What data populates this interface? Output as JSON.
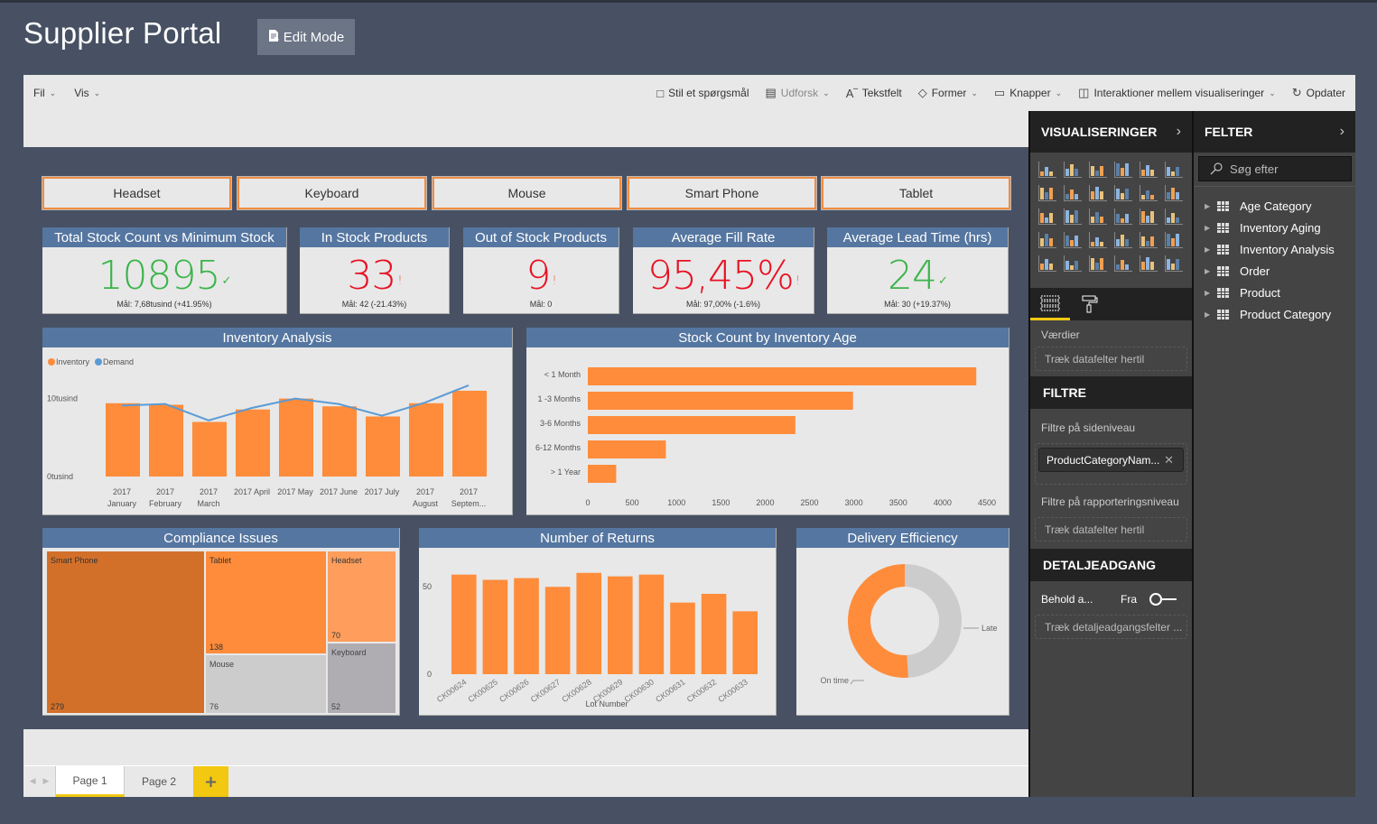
{
  "app": {
    "title": "Supplier Portal",
    "edit_mode_label": "Edit Mode"
  },
  "ribbon": {
    "left": [
      {
        "label": "Fil"
      },
      {
        "label": "Vis"
      }
    ],
    "right": [
      {
        "label": "Stil et spørgsmål",
        "icon": "speech-bubble-icon",
        "dropdown": false,
        "enabled": true
      },
      {
        "label": "Udforsk",
        "icon": "explore-icon",
        "dropdown": true,
        "enabled": false
      },
      {
        "label": "Tekstfelt",
        "icon": "textbox-icon",
        "dropdown": false,
        "enabled": true
      },
      {
        "label": "Former",
        "icon": "shapes-icon",
        "dropdown": true,
        "enabled": true
      },
      {
        "label": "Knapper",
        "icon": "buttons-icon",
        "dropdown": true,
        "enabled": true
      },
      {
        "label": "Interaktioner mellem visualiseringer",
        "icon": "interactions-icon",
        "dropdown": true,
        "enabled": true
      },
      {
        "label": "Opdater",
        "icon": "refresh-icon",
        "dropdown": false,
        "enabled": true
      }
    ]
  },
  "slicers": [
    "Headset",
    "Keyboard",
    "Mouse",
    "Smart Phone",
    "Tablet"
  ],
  "kpis": [
    {
      "title": "Total Stock Count vs Minimum Stock",
      "value": "10895",
      "status": "good",
      "flag": "✓",
      "goal": "Mål: 7,68tusind (+41.95%)"
    },
    {
      "title": "In Stock Products",
      "value": "33",
      "status": "bad",
      "flag": "!",
      "goal": "Mål: 42 (-21.43%)"
    },
    {
      "title": "Out of Stock Products",
      "value": "9",
      "status": "bad",
      "flag": "!",
      "goal": "Mål: 0"
    },
    {
      "title": "Average Fill Rate",
      "value": "95,45%",
      "status": "bad",
      "flag": "!",
      "goal": "Mål: 97,00% (-1.6%)"
    },
    {
      "title": "Average Lead Time (hrs)",
      "value": "24",
      "status": "good",
      "flag": "✓",
      "goal": "Mål: 30 (+19.37%)"
    }
  ],
  "colors": {
    "orange": "#fe8c3b",
    "blue": "#5b9bd5",
    "dark_orange": "#d2702a",
    "light_orange": "#ff9e5c",
    "grey": "#cccccc",
    "dark_grey": "#b0adb2",
    "title_bar": "#5576a0",
    "accent_yellow": "#f2c811"
  },
  "chart_data": [
    {
      "id": "inventory-analysis",
      "type": "bar",
      "title": "Inventory Analysis",
      "legend": [
        "Inventory",
        "Demand"
      ],
      "legend_position": "top-left",
      "categories": [
        "2017 January",
        "2017 February",
        "2017 March",
        "2017 April",
        "2017 May",
        "2017 June",
        "2017 July",
        "2017 August",
        "2017 Septem..."
      ],
      "category_lines": [
        [
          "2017",
          "January"
        ],
        [
          "2017",
          "February"
        ],
        [
          "2017",
          "March"
        ],
        [
          "2017 April"
        ],
        [
          "2017 May"
        ],
        [
          "2017 June"
        ],
        [
          "2017 July"
        ],
        [
          "2017",
          "August"
        ],
        [
          "2017",
          "Septem..."
        ]
      ],
      "series": [
        {
          "name": "Inventory",
          "type": "bar",
          "values": [
            9400,
            9200,
            7000,
            8600,
            10000,
            9000,
            7700,
            9400,
            11000
          ]
        },
        {
          "name": "Demand",
          "type": "line",
          "values": [
            9100,
            9300,
            7200,
            8800,
            10000,
            9300,
            7800,
            9500,
            11700
          ]
        }
      ],
      "yticks": [
        "0tusind",
        "10tusind"
      ],
      "ytick_values": [
        0,
        10000
      ],
      "ylim": [
        0,
        12500
      ]
    },
    {
      "id": "stock-by-age",
      "type": "bar",
      "orientation": "horizontal",
      "title": "Stock Count by Inventory Age",
      "categories": [
        "< 1 Month",
        "1 -3 Months",
        "3-6 Months",
        "6-12 Months",
        "> 1 Year"
      ],
      "values": [
        4380,
        2990,
        2340,
        880,
        320
      ],
      "xticks": [
        0,
        500,
        1000,
        1500,
        2000,
        2500,
        3000,
        3500,
        4000,
        4500
      ],
      "xlim": [
        0,
        4500
      ]
    },
    {
      "id": "compliance-issues",
      "type": "treemap",
      "title": "Compliance Issues",
      "items": [
        {
          "label": "Smart Phone",
          "value": 279
        },
        {
          "label": "Tablet",
          "value": 138
        },
        {
          "label": "Mouse",
          "value": 76
        },
        {
          "label": "Headset",
          "value": 70
        },
        {
          "label": "Keyboard",
          "value": 52
        }
      ]
    },
    {
      "id": "number-of-returns",
      "type": "bar",
      "title": "Number of Returns",
      "xlabel": "Lot Number",
      "categories": [
        "CK00624",
        "CK00625",
        "CK00626",
        "CK00627",
        "CK00628",
        "CK00629",
        "CK00630",
        "CK00631",
        "CK00632",
        "CK00633"
      ],
      "values": [
        57,
        54,
        55,
        50,
        58,
        56,
        57,
        41,
        46,
        36
      ],
      "yticks": [
        0,
        50
      ],
      "ylim": [
        0,
        62
      ]
    },
    {
      "id": "delivery-efficiency",
      "type": "pie",
      "donut": true,
      "title": "Delivery Efficiency",
      "items": [
        {
          "label": "Late",
          "value": 49
        },
        {
          "label": "On time",
          "value": 51
        }
      ]
    }
  ],
  "viz_pane": {
    "title": "VISUALISERINGER",
    "values_label": "Værdier",
    "drop_placeholder": "Træk datafelter hertil",
    "filters_title": "FILTRE",
    "page_filters_label": "Filtre på sideniveau",
    "filter_chip": "ProductCategoryNam...",
    "report_filters_label": "Filtre på rapporteringsniveau",
    "report_drop_placeholder": "Træk datafelter hertil",
    "drill_title": "DETALJEADGANG",
    "keep_label": "Behold a...",
    "toggle_state": "Fra",
    "drill_placeholder": "Træk detaljeadgangsfelter ..."
  },
  "fields_pane": {
    "title": "FELTER",
    "search_placeholder": "Søg efter",
    "tables": [
      "Age Category",
      "Inventory Aging",
      "Inventory Analysis",
      "Order",
      "Product",
      "Product Category"
    ]
  },
  "pages": {
    "tabs": [
      "Page 1",
      "Page 2"
    ],
    "active": 0,
    "add_label": "+"
  }
}
